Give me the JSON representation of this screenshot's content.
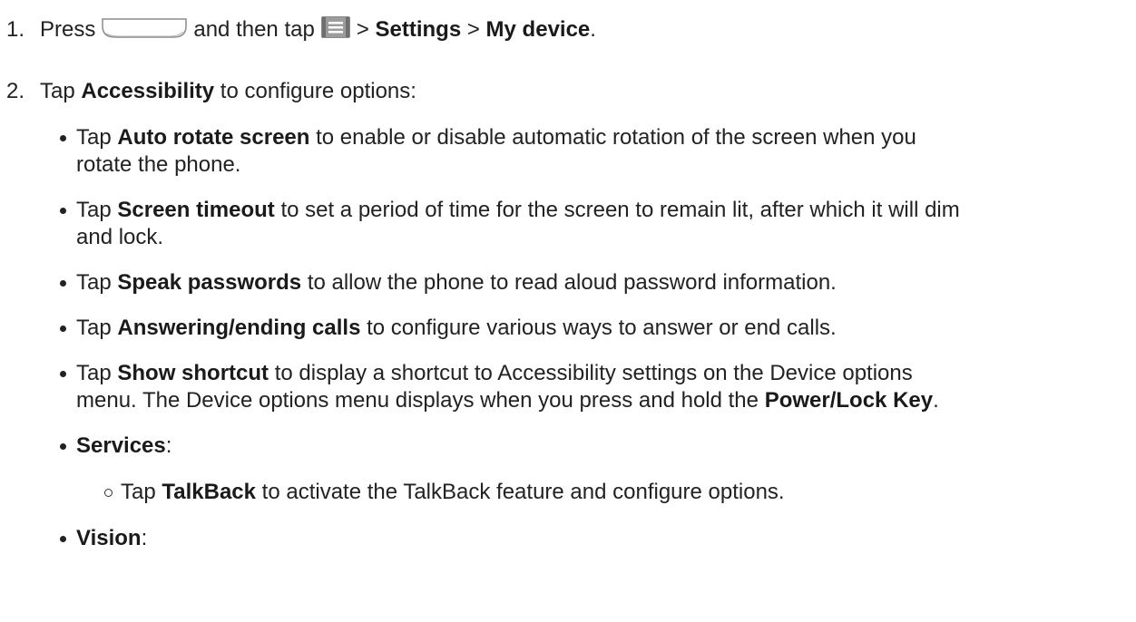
{
  "steps": [
    {
      "number": "1.",
      "parts": {
        "a": "Press",
        "b": "and then tap",
        "c": ">",
        "d": "Settings",
        "e": ">",
        "f": "My device",
        "g": "."
      }
    },
    {
      "number": "2.",
      "parts": {
        "a": "Tap",
        "b": "Accessibility",
        "c": "to configure options:"
      }
    }
  ],
  "icons": {
    "home_key": "home-key-icon",
    "menu": "menu-key-icon"
  },
  "bullets": [
    {
      "a": "Tap",
      "bold": "Auto rotate screen",
      "rest1": "to enable or disable automatic rotation of the screen when you",
      "rest2": "rotate the phone."
    },
    {
      "a": "Tap",
      "bold": "Screen timeout",
      "rest1": "to set a period of time for the screen to remain lit, after which it will dim",
      "rest2": "and lock."
    },
    {
      "a": "Tap",
      "bold": "Speak passwords",
      "rest1": "to allow the phone to read aloud password information."
    },
    {
      "a": "Tap",
      "bold": "Answering/ending calls",
      "rest1": "to configure various ways to answer or end calls."
    },
    {
      "a": "Tap",
      "bold": "Show shortcut",
      "rest1": "to display a shortcut to Accessibility settings on the Device options",
      "rest2a": "menu. The Device options menu displays when you press and hold the",
      "rest2b": "Power/Lock Key",
      "rest2c": "."
    },
    {
      "bold": "Services",
      "rest1": ":"
    },
    {
      "bold": "Vision",
      "rest1": ":"
    }
  ],
  "sub_bullets": [
    {
      "a": "Tap",
      "bold": "TalkBack",
      "rest1": "to activate the TalkBack feature and configure options."
    }
  ]
}
